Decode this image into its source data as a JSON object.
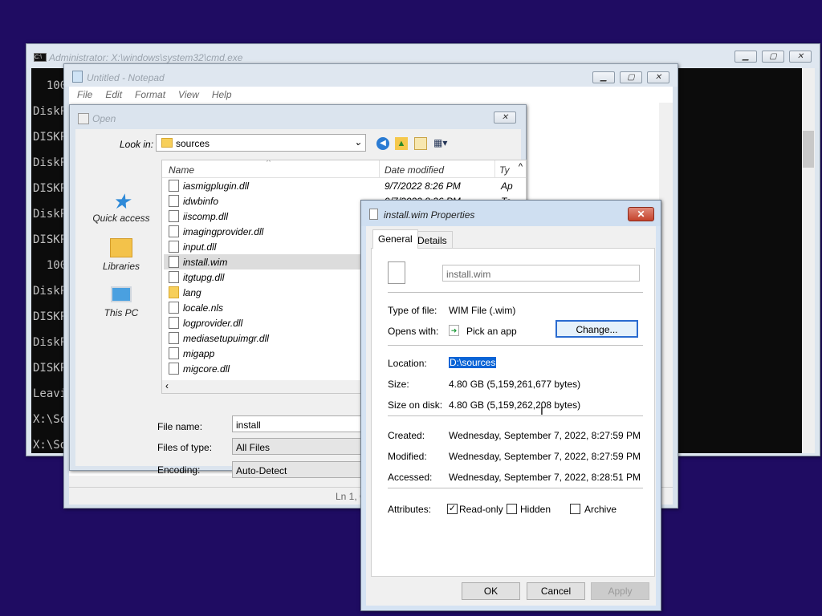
{
  "cmd_window": {
    "title": "Administrator: X:\\windows\\system32\\cmd.exe",
    "lines": [
      "  100",
      "DiskP",
      "DISKP",
      "DiskP",
      "DISKP",
      "DiskP",
      "DISKP",
      "  100",
      "DiskP",
      "DISKP",
      "DiskP",
      "DISKP",
      "Leavi",
      "X:\\So",
      "X:\\So"
    ]
  },
  "notepad": {
    "title": "Untitled - Notepad",
    "menu": [
      "File",
      "Edit",
      "Format",
      "View",
      "Help"
    ],
    "status": "Ln 1, C"
  },
  "open_dialog": {
    "title": "Open",
    "look_in_label": "Look in:",
    "look_in_value": "sources",
    "places": [
      "Quick access",
      "Libraries",
      "This PC"
    ],
    "columns": {
      "name": "Name",
      "date": "Date modified",
      "type": "Ty"
    },
    "files": [
      {
        "name": "iasmigplugin.dll",
        "date": "9/7/2022 8:26 PM",
        "type": "Ap"
      },
      {
        "name": "idwbinfo",
        "date": "9/7/2022 8:26 PM",
        "type": "Te"
      },
      {
        "name": "iiscomp.dll",
        "date": "",
        "type": ""
      },
      {
        "name": "imagingprovider.dll",
        "date": "",
        "type": ""
      },
      {
        "name": "input.dll",
        "date": "",
        "type": ""
      },
      {
        "name": "install.wim",
        "date": "",
        "type": ""
      },
      {
        "name": "itgtupg.dll",
        "date": "",
        "type": ""
      },
      {
        "name": "lang",
        "date": "",
        "type": ""
      },
      {
        "name": "locale.nls",
        "date": "",
        "type": ""
      },
      {
        "name": "logprovider.dll",
        "date": "",
        "type": ""
      },
      {
        "name": "mediasetupuimgr.dll",
        "date": "",
        "type": ""
      },
      {
        "name": "migapp",
        "date": "",
        "type": ""
      },
      {
        "name": "migcore.dll",
        "date": "",
        "type": ""
      }
    ],
    "selected_file": "install.wim",
    "file_name_label": "File name:",
    "file_name_value": "install",
    "file_type_label": "Files of type:",
    "file_type_value": "All Files",
    "encoding_label": "Encoding:",
    "encoding_value": "Auto-Detect"
  },
  "properties": {
    "title": "install.wim Properties",
    "tabs": [
      "General",
      "Details"
    ],
    "file_name": "install.wim",
    "type_label": "Type of file:",
    "type_value": "WIM File (.wim)",
    "opens_label": "Opens with:",
    "opens_value": "Pick an app",
    "change_button": "Change...",
    "location_label": "Location:",
    "location_value": "D:\\sources",
    "size_label": "Size:",
    "size_value": "4.80 GB (5,159,261,677 bytes)",
    "size_disk_label": "Size on disk:",
    "size_disk_value": "4.80 GB (5,159,262,208 bytes)",
    "created_label": "Created:",
    "created_value": "Wednesday, September 7, 2022, 8:27:59 PM",
    "modified_label": "Modified:",
    "modified_value": "Wednesday, September 7, 2022, 8:27:59 PM",
    "accessed_label": "Accessed:",
    "accessed_value": "Wednesday, September 7, 2022, 8:28:51 PM",
    "attributes_label": "Attributes:",
    "readonly_label": "Read-only",
    "readonly_checked": true,
    "hidden_label": "Hidden",
    "archive_label": "Archive",
    "ok": "OK",
    "cancel": "Cancel",
    "apply": "Apply"
  }
}
